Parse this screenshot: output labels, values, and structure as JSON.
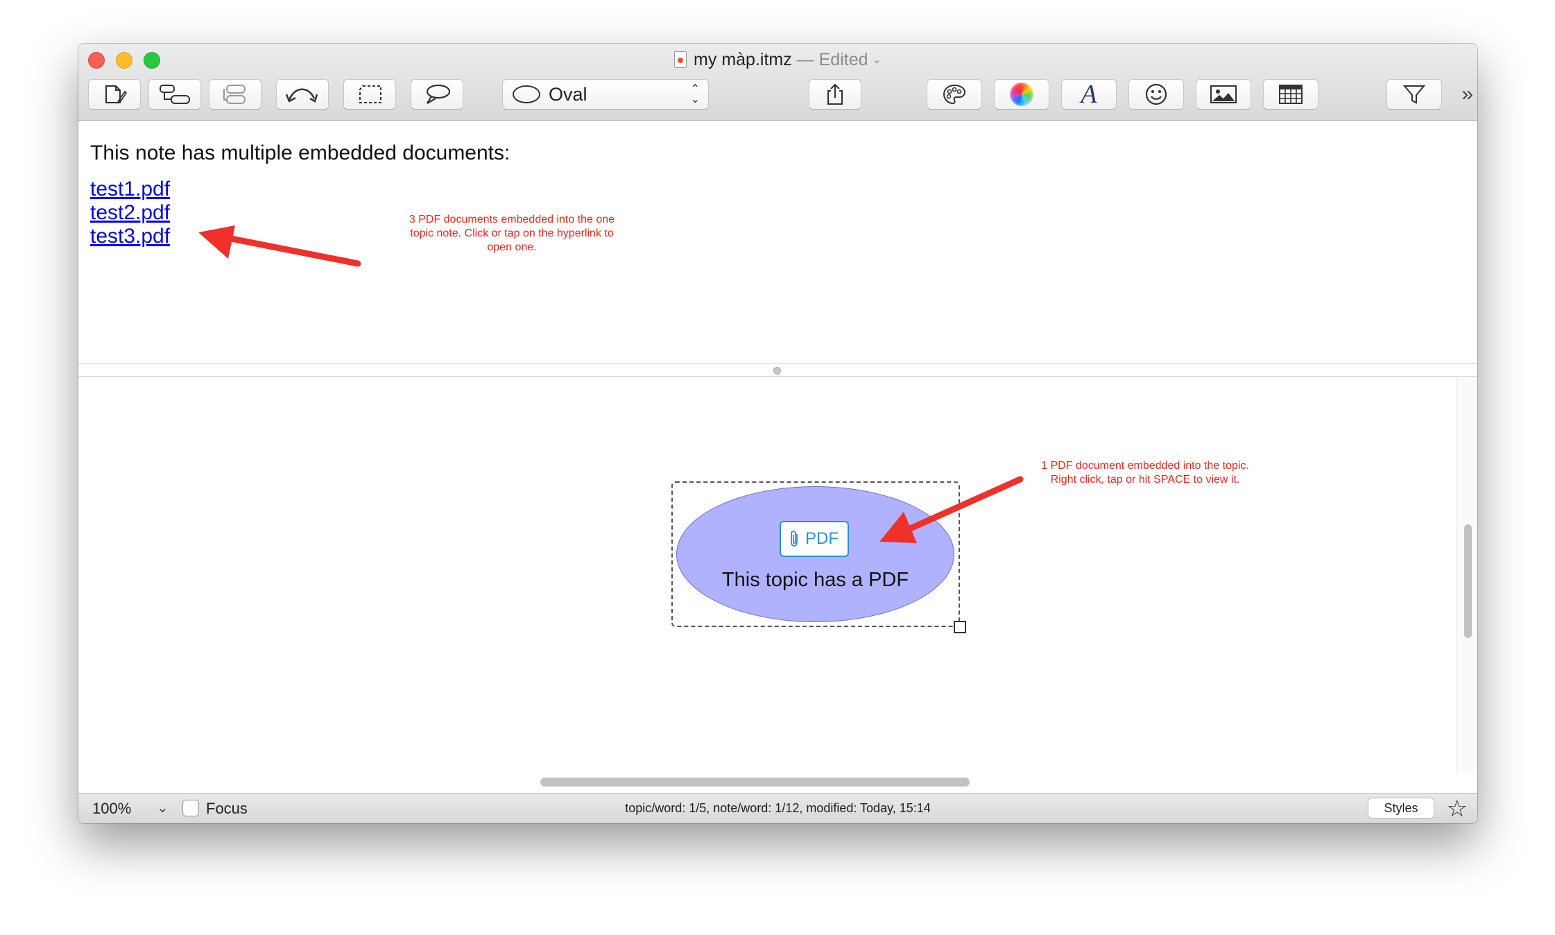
{
  "window": {
    "title": "my màp.itmz",
    "edited_suffix": "— Edited"
  },
  "toolbar": {
    "shape_select_value": "Oval",
    "overflow": "»"
  },
  "note": {
    "heading": "This note has multiple embedded documents:",
    "links": [
      "test1.pdf",
      "test2.pdf",
      "test3.pdf"
    ],
    "annotation_lines": [
      "3 PDF documents embedded into the one",
      "topic note. Click or tap on the hyperlink to",
      "open one."
    ]
  },
  "map": {
    "topic_label": "This topic has a PDF",
    "attachment_badge": "PDF",
    "annotation_lines": [
      "1 PDF document embedded into the topic.",
      "Right click, tap or hit SPACE to view it."
    ]
  },
  "statusbar": {
    "zoom": "100%",
    "focus_label": "Focus",
    "status": "topic/word: 1/5, note/word: 1/12, modified: Today, 15:14",
    "styles_button": "Styles"
  },
  "colors": {
    "topic_fill": "#b0b2ff",
    "annotation_red": "#e8261f",
    "link_blue": "#0000ee",
    "attachment_blue": "#2a8fd8"
  },
  "icons": [
    "new-note-icon",
    "add-subtopic-icon",
    "add-sibling-icon",
    "relation-arrow-icon",
    "boundary-icon",
    "callout-icon",
    "oval-shape-icon",
    "share-icon",
    "palette-icon",
    "color-wheel-icon",
    "font-icon",
    "emoji-icon",
    "image-icon",
    "table-icon",
    "filter-icon",
    "paperclip-icon",
    "star-icon"
  ]
}
